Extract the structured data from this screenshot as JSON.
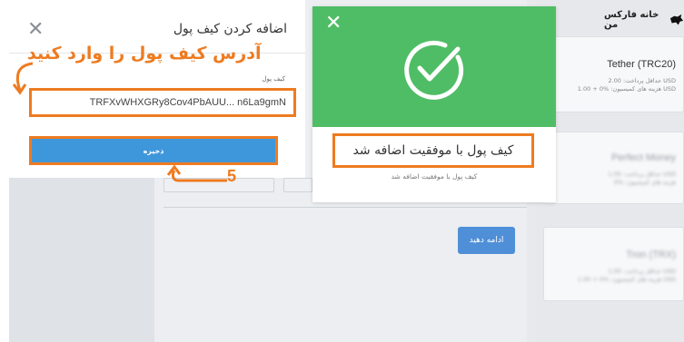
{
  "background": {
    "continue_button": "ادامه دهید",
    "brand_name": "خانه فارکس من",
    "cards": [
      {
        "title": "Tether (TRC20)",
        "min_payment": "حداقل پرداخت: 2.00 USD",
        "fee": "هزینه های کمیسیون: %0 + 1.00 USD"
      },
      {
        "title": "Perfect Money",
        "min_payment": "حداقل پرداخت: 1.00 USD",
        "fee": "هزینه های کمیسیون: %0"
      },
      {
        "title": "Tron (TRX)",
        "min_payment": "حداقل پرداخت: 1.00 USD",
        "fee": "هزینه های کمیسیون: %0 + 1.00 USD"
      }
    ]
  },
  "add_wallet_modal": {
    "title": "اضافه کردن کیف پول",
    "annotation": "آدرس کیف پول را وارد کنید",
    "field_label": "کیف پول",
    "wallet_value": "TRFXvWHXGRy8Cov4PbAUU... n6La9gmN",
    "save_label": "ذخیره",
    "step_number": "5"
  },
  "success_modal": {
    "message": "کیف پول با موفقیت اضافه شد",
    "sub_message": "کیف پول با موفقیت اضافه شد"
  },
  "colors": {
    "accent_orange": "#ee7b20",
    "success_green": "#4fbd65",
    "button_blue": "#3f97db"
  }
}
